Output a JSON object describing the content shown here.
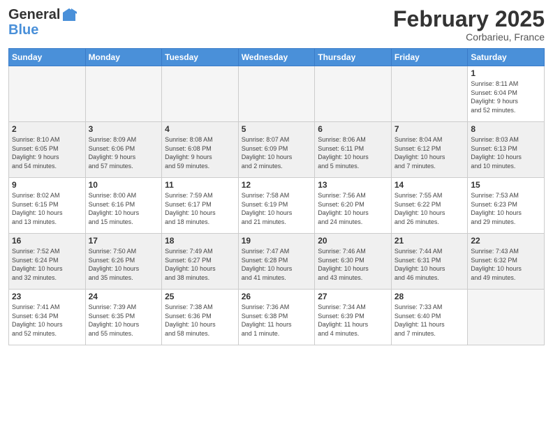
{
  "header": {
    "logo_general": "General",
    "logo_blue": "Blue",
    "month_title": "February 2025",
    "location": "Corbarieu, France"
  },
  "days_of_week": [
    "Sunday",
    "Monday",
    "Tuesday",
    "Wednesday",
    "Thursday",
    "Friday",
    "Saturday"
  ],
  "weeks": [
    {
      "shade": false,
      "days": [
        {
          "num": "",
          "info": ""
        },
        {
          "num": "",
          "info": ""
        },
        {
          "num": "",
          "info": ""
        },
        {
          "num": "",
          "info": ""
        },
        {
          "num": "",
          "info": ""
        },
        {
          "num": "",
          "info": ""
        },
        {
          "num": "1",
          "info": "Sunrise: 8:11 AM\nSunset: 6:04 PM\nDaylight: 9 hours\nand 52 minutes."
        }
      ]
    },
    {
      "shade": true,
      "days": [
        {
          "num": "2",
          "info": "Sunrise: 8:10 AM\nSunset: 6:05 PM\nDaylight: 9 hours\nand 54 minutes."
        },
        {
          "num": "3",
          "info": "Sunrise: 8:09 AM\nSunset: 6:06 PM\nDaylight: 9 hours\nand 57 minutes."
        },
        {
          "num": "4",
          "info": "Sunrise: 8:08 AM\nSunset: 6:08 PM\nDaylight: 9 hours\nand 59 minutes."
        },
        {
          "num": "5",
          "info": "Sunrise: 8:07 AM\nSunset: 6:09 PM\nDaylight: 10 hours\nand 2 minutes."
        },
        {
          "num": "6",
          "info": "Sunrise: 8:06 AM\nSunset: 6:11 PM\nDaylight: 10 hours\nand 5 minutes."
        },
        {
          "num": "7",
          "info": "Sunrise: 8:04 AM\nSunset: 6:12 PM\nDaylight: 10 hours\nand 7 minutes."
        },
        {
          "num": "8",
          "info": "Sunrise: 8:03 AM\nSunset: 6:13 PM\nDaylight: 10 hours\nand 10 minutes."
        }
      ]
    },
    {
      "shade": false,
      "days": [
        {
          "num": "9",
          "info": "Sunrise: 8:02 AM\nSunset: 6:15 PM\nDaylight: 10 hours\nand 13 minutes."
        },
        {
          "num": "10",
          "info": "Sunrise: 8:00 AM\nSunset: 6:16 PM\nDaylight: 10 hours\nand 15 minutes."
        },
        {
          "num": "11",
          "info": "Sunrise: 7:59 AM\nSunset: 6:17 PM\nDaylight: 10 hours\nand 18 minutes."
        },
        {
          "num": "12",
          "info": "Sunrise: 7:58 AM\nSunset: 6:19 PM\nDaylight: 10 hours\nand 21 minutes."
        },
        {
          "num": "13",
          "info": "Sunrise: 7:56 AM\nSunset: 6:20 PM\nDaylight: 10 hours\nand 24 minutes."
        },
        {
          "num": "14",
          "info": "Sunrise: 7:55 AM\nSunset: 6:22 PM\nDaylight: 10 hours\nand 26 minutes."
        },
        {
          "num": "15",
          "info": "Sunrise: 7:53 AM\nSunset: 6:23 PM\nDaylight: 10 hours\nand 29 minutes."
        }
      ]
    },
    {
      "shade": true,
      "days": [
        {
          "num": "16",
          "info": "Sunrise: 7:52 AM\nSunset: 6:24 PM\nDaylight: 10 hours\nand 32 minutes."
        },
        {
          "num": "17",
          "info": "Sunrise: 7:50 AM\nSunset: 6:26 PM\nDaylight: 10 hours\nand 35 minutes."
        },
        {
          "num": "18",
          "info": "Sunrise: 7:49 AM\nSunset: 6:27 PM\nDaylight: 10 hours\nand 38 minutes."
        },
        {
          "num": "19",
          "info": "Sunrise: 7:47 AM\nSunset: 6:28 PM\nDaylight: 10 hours\nand 41 minutes."
        },
        {
          "num": "20",
          "info": "Sunrise: 7:46 AM\nSunset: 6:30 PM\nDaylight: 10 hours\nand 43 minutes."
        },
        {
          "num": "21",
          "info": "Sunrise: 7:44 AM\nSunset: 6:31 PM\nDaylight: 10 hours\nand 46 minutes."
        },
        {
          "num": "22",
          "info": "Sunrise: 7:43 AM\nSunset: 6:32 PM\nDaylight: 10 hours\nand 49 minutes."
        }
      ]
    },
    {
      "shade": false,
      "days": [
        {
          "num": "23",
          "info": "Sunrise: 7:41 AM\nSunset: 6:34 PM\nDaylight: 10 hours\nand 52 minutes."
        },
        {
          "num": "24",
          "info": "Sunrise: 7:39 AM\nSunset: 6:35 PM\nDaylight: 10 hours\nand 55 minutes."
        },
        {
          "num": "25",
          "info": "Sunrise: 7:38 AM\nSunset: 6:36 PM\nDaylight: 10 hours\nand 58 minutes."
        },
        {
          "num": "26",
          "info": "Sunrise: 7:36 AM\nSunset: 6:38 PM\nDaylight: 11 hours\nand 1 minute."
        },
        {
          "num": "27",
          "info": "Sunrise: 7:34 AM\nSunset: 6:39 PM\nDaylight: 11 hours\nand 4 minutes."
        },
        {
          "num": "28",
          "info": "Sunrise: 7:33 AM\nSunset: 6:40 PM\nDaylight: 11 hours\nand 7 minutes."
        },
        {
          "num": "",
          "info": ""
        }
      ]
    }
  ]
}
